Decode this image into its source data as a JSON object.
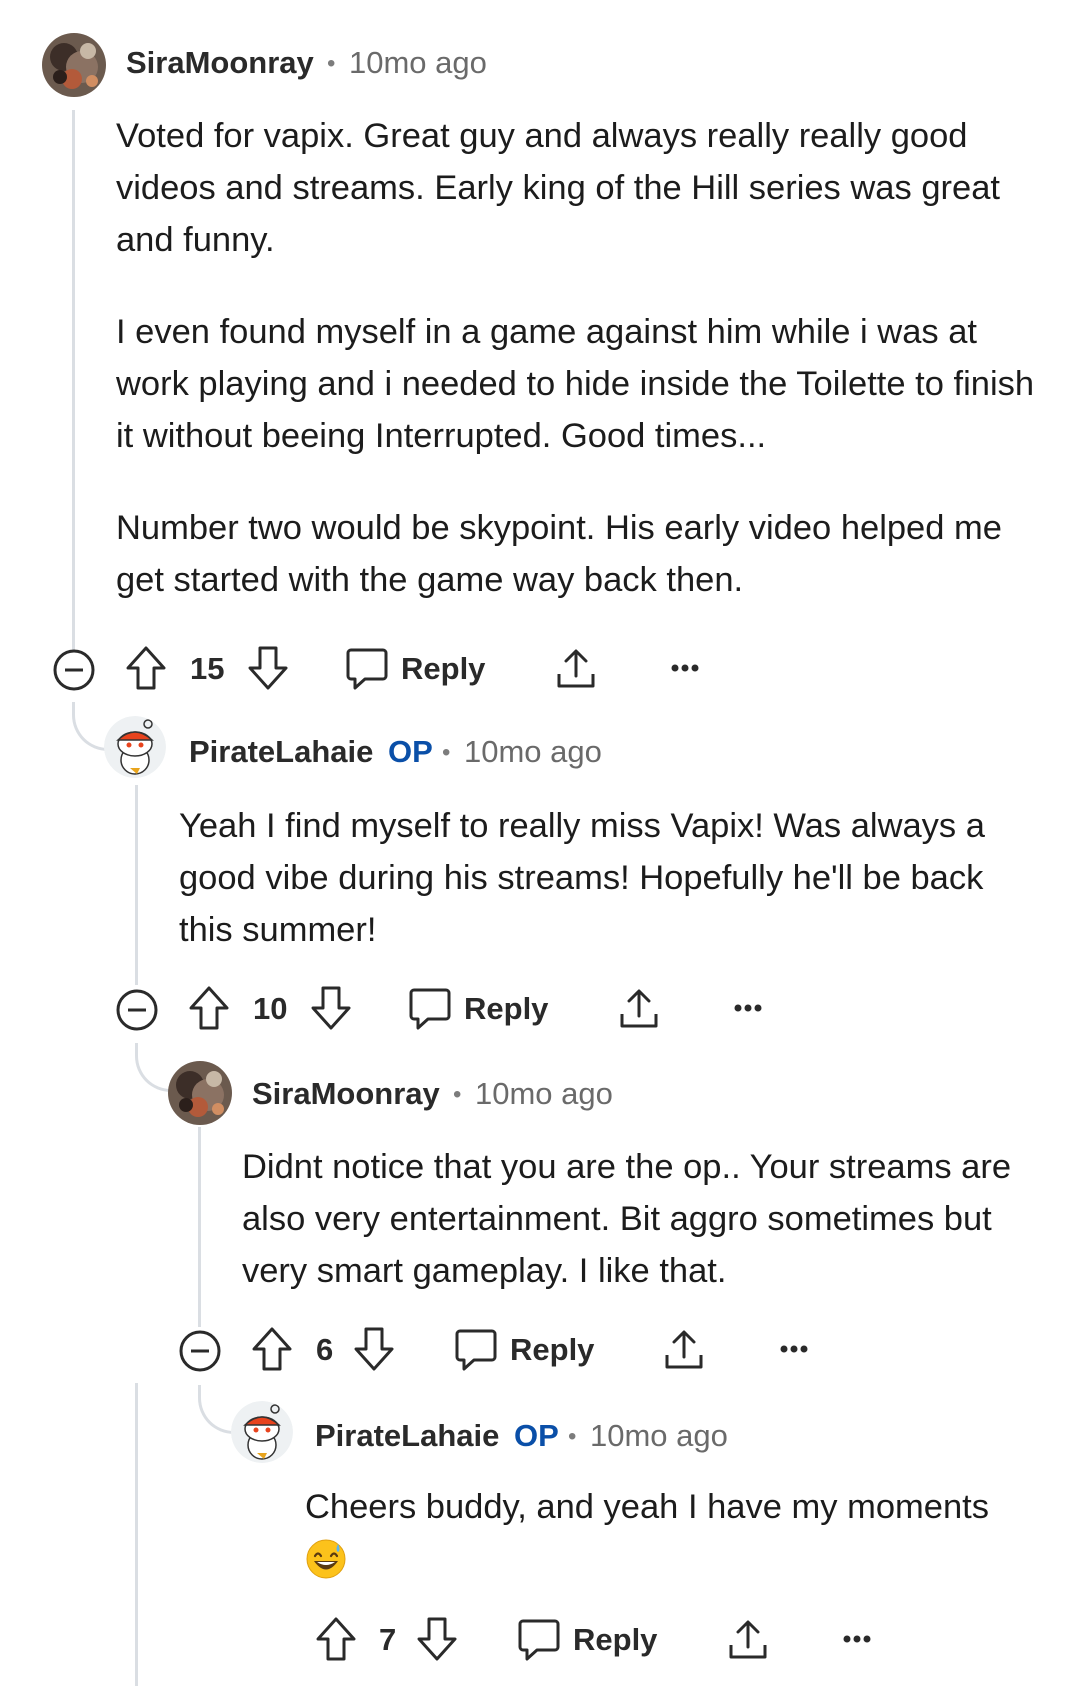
{
  "comments": [
    {
      "username": "SiraMoonray",
      "time": "10mo ago",
      "paragraphs": [
        "Voted for vapix. Great guy and always really really good videos and streams. Early king of the Hill series was great and funny.",
        "I even found myself in a game against him while i was at work playing and i needed to hide inside the Toilette to finish it without beeing Interrupted. Good times...",
        "Number two would be skypoint. His early video helped me get started with the game way back then."
      ],
      "votes": "15",
      "reply_label": "Reply"
    },
    {
      "username": "PirateLahaie",
      "op_badge": "OP",
      "time": "10mo ago",
      "paragraphs": [
        "Yeah I find myself to really miss Vapix! Was always a good vibe during his streams! Hopefully he'll be back this summer!"
      ],
      "votes": "10",
      "reply_label": "Reply"
    },
    {
      "username": "SiraMoonray",
      "time": "10mo ago",
      "paragraphs": [
        "Didnt notice that you are the op.. Your streams are also very entertainment. Bit aggro sometimes but very smart gameplay. I like that."
      ],
      "votes": "6",
      "reply_label": "Reply"
    },
    {
      "username": "PirateLahaie",
      "op_badge": "OP",
      "time": "10mo ago",
      "paragraphs": [
        "Cheers buddy, and yeah I have my moments"
      ],
      "emoji": "😅",
      "votes": "7",
      "reply_label": "Reply"
    }
  ],
  "separator": "•",
  "icons": {
    "collapse": "collapse-minus-icon",
    "upvote": "upvote-arrow-icon",
    "downvote": "downvote-arrow-icon",
    "reply": "reply-bubble-icon",
    "share": "share-icon",
    "more": "more-dots-icon"
  },
  "colors": {
    "op_badge": "#0a4fa8",
    "thread_line": "#dadee3",
    "text": "#1c1c1c",
    "meta": "#6a6a6a"
  }
}
